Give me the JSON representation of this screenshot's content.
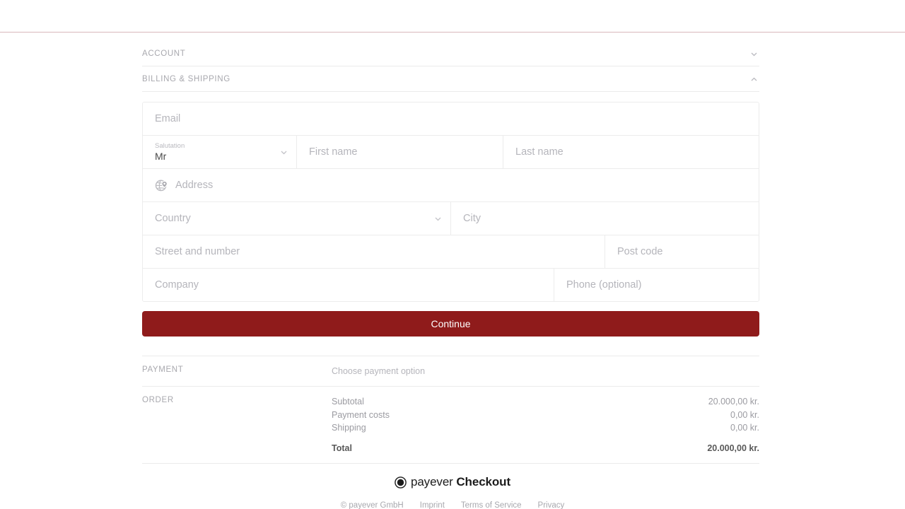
{
  "sections": {
    "account": {
      "title": "ACCOUNT",
      "chevron": "chevron-down-icon",
      "expanded": false
    },
    "billing": {
      "title": "BILLING & SHIPPING",
      "chevron": "chevron-up-icon",
      "expanded": true
    }
  },
  "form": {
    "email": {
      "placeholder": "Email",
      "value": ""
    },
    "salutation": {
      "label": "Salutation",
      "value": "Mr",
      "chevron": "chevron-down-icon"
    },
    "first_name": {
      "placeholder": "First name",
      "value": ""
    },
    "last_name": {
      "placeholder": "Last name",
      "value": ""
    },
    "address": {
      "placeholder": "Address",
      "value": "",
      "icon": "globe-pin-icon"
    },
    "country": {
      "placeholder": "Country",
      "value": "",
      "chevron": "chevron-down-icon"
    },
    "city": {
      "placeholder": "City",
      "value": ""
    },
    "street": {
      "placeholder": "Street and number",
      "value": ""
    },
    "post_code": {
      "placeholder": "Post code",
      "value": ""
    },
    "company": {
      "placeholder": "Company",
      "value": ""
    },
    "phone": {
      "placeholder": "Phone (optional)",
      "value": ""
    }
  },
  "continue_button": {
    "label": "Continue",
    "color": "#8f1b1b"
  },
  "payment": {
    "label": "PAYMENT",
    "choose_text": "Choose payment option"
  },
  "order": {
    "label": "ORDER",
    "lines": [
      {
        "name": "Subtotal",
        "amount": "20.000,00 kr."
      },
      {
        "name": "Payment costs",
        "amount": "0,00 kr."
      },
      {
        "name": "Shipping",
        "amount": "0,00 kr."
      }
    ],
    "total": {
      "name": "Total",
      "amount": "20.000,00 kr."
    }
  },
  "footer": {
    "brand_mark": "payever-circle-icon",
    "brand_name": "payever",
    "brand_product": "Checkout",
    "links": [
      {
        "label": "© payever GmbH"
      },
      {
        "label": "Imprint"
      },
      {
        "label": "Terms of Service"
      },
      {
        "label": "Privacy"
      }
    ]
  },
  "theme": {
    "accent": "#8f1b1b",
    "top_rule": "#d9b8bc",
    "border": "#ececec",
    "placeholder": "#b5b5bb",
    "muted": "#a8a8ae"
  }
}
